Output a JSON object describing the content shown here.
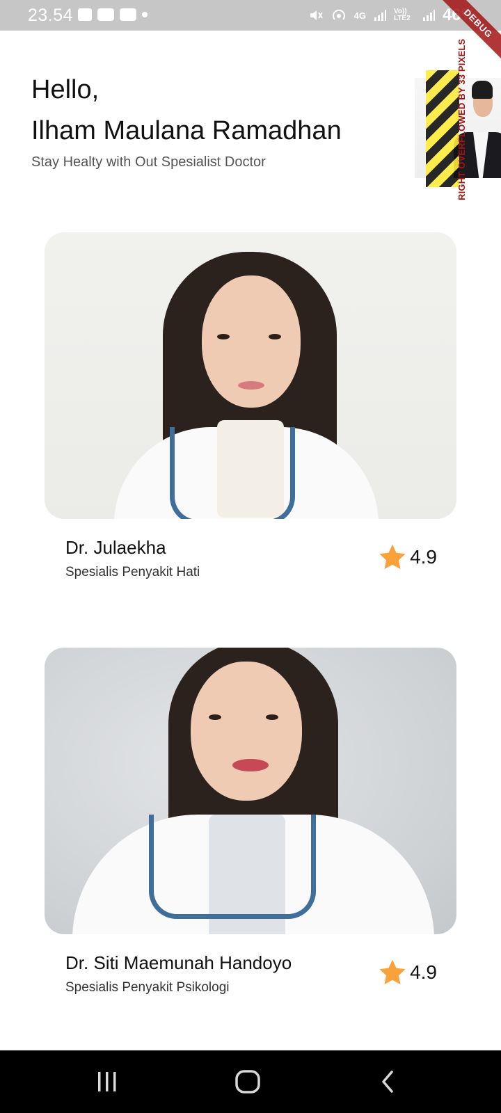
{
  "status_bar": {
    "time": "23.54",
    "network": "4G",
    "volte": "Vo)) LTE2",
    "battery": "46%"
  },
  "debug_banner": "DEBUG",
  "overflow_warning": "RIGHT OVERFLOWED BY 33 PIXELS",
  "header": {
    "greeting": "Hello,",
    "user_name": "Ilham Maulana Ramadhan",
    "subtitle": "Stay Healty with Out Spesialist Doctor"
  },
  "doctors": [
    {
      "name": "Dr. Julaekha",
      "specialty": "Spesialis Penyakit Hati",
      "rating": "4.9"
    },
    {
      "name": "Dr. Siti Maemunah Handoyo",
      "specialty": "Spesialis Penyakit Psikologi",
      "rating": "4.9"
    }
  ],
  "colors": {
    "star": "#f9a13a",
    "status_bar_bg": "#c6c6c6",
    "nav_bar_bg": "#000000",
    "debug_banner": "#a31515"
  },
  "icons": {
    "status": [
      "gallery-icon",
      "video-call-icon",
      "video-icon",
      "dot-icon",
      "mute-icon",
      "hotspot-icon",
      "signal-icon",
      "battery-icon"
    ],
    "nav": [
      "recent-apps-icon",
      "home-icon",
      "back-icon"
    ],
    "rating": "star-icon"
  }
}
